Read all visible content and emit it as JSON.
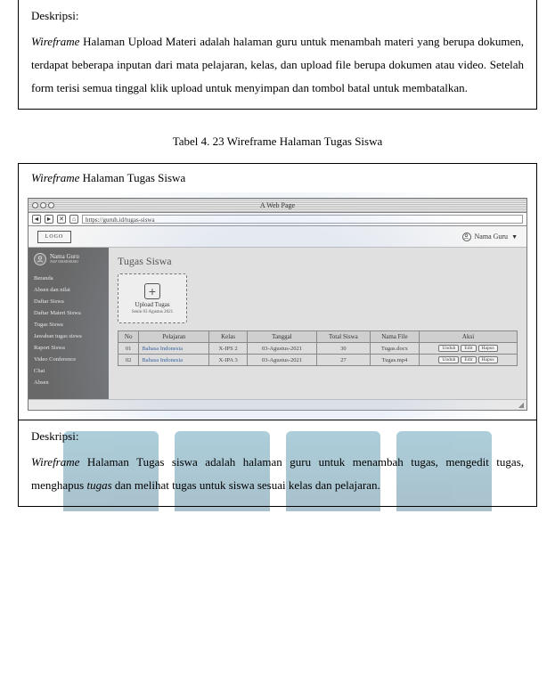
{
  "topBox": {
    "label": "Deskripsi:",
    "text_prefix_italic": "Wireframe",
    "text_rest": " Halaman Upload Materi adalah halaman guru untuk menambah materi yang berupa dokumen, terdapat beberapa inputan dari mata pelajaran, kelas, dan upload file berupa dokumen atau video. Setelah form terisi semua tinggal klik upload untuk menyimpan dan tombol batal untuk membatalkan."
  },
  "caption": "Tabel 4. 23 Wireframe Halaman Tugas Siswa",
  "wfTitle": {
    "italic": "Wireframe",
    "rest": " Halaman Tugas Siswa"
  },
  "browser": {
    "tab_label": "A Web Page",
    "url": "https://guruh.id/tugas-siswa",
    "logo": "LOGO",
    "user_name_top": "Nama Guru",
    "sidebar_user": {
      "name": "Nama Guru",
      "sub": "NIP 000000000"
    },
    "menu": [
      "Beranda",
      "Absen dan nilai",
      "Daftar Siswa",
      "Daftar Materi Siswa",
      "Tugas Siswa",
      "Jawaban tugas siswa",
      "Raport Siswa",
      "Video Conference",
      "Chat",
      "Absen"
    ],
    "page_title": "Tugas Siswa",
    "upload": {
      "title": "Upload Tugas",
      "sub": "Senin 03 Agustus 2021"
    },
    "table": {
      "headers": [
        "No",
        "Pelajaran",
        "Kelas",
        "Tanggal",
        "Total Siswa",
        "Nama File",
        "Aksi"
      ],
      "rows": [
        {
          "no": "01",
          "pelajaran": "Bahasa Indonesia",
          "kelas": "X-IPS 2",
          "tanggal": "03-Agustus-2021",
          "total": "30",
          "file": "Tugas.docx",
          "aksi": [
            "Unduh",
            "Edit",
            "Hapus"
          ]
        },
        {
          "no": "02",
          "pelajaran": "Bahasa Indonesia",
          "kelas": "X-IPA 3",
          "tanggal": "03-Agustus-2021",
          "total": "27",
          "file": "Tugas.mp4",
          "aksi": [
            "Unduh",
            "Edit",
            "Hapus"
          ]
        }
      ]
    }
  },
  "bottomBox": {
    "label": "Deskripsi:",
    "parts": [
      {
        "italic": true,
        "text": "Wireframe"
      },
      {
        "italic": false,
        "text": " Halaman Tugas siswa adalah halaman guru untuk menambah tugas, mengedit tugas, menghapus "
      },
      {
        "italic": true,
        "text": "tugas"
      },
      {
        "italic": false,
        "text": " dan melihat tugas untuk siswa sesuai kelas dan pelajaran."
      }
    ]
  }
}
